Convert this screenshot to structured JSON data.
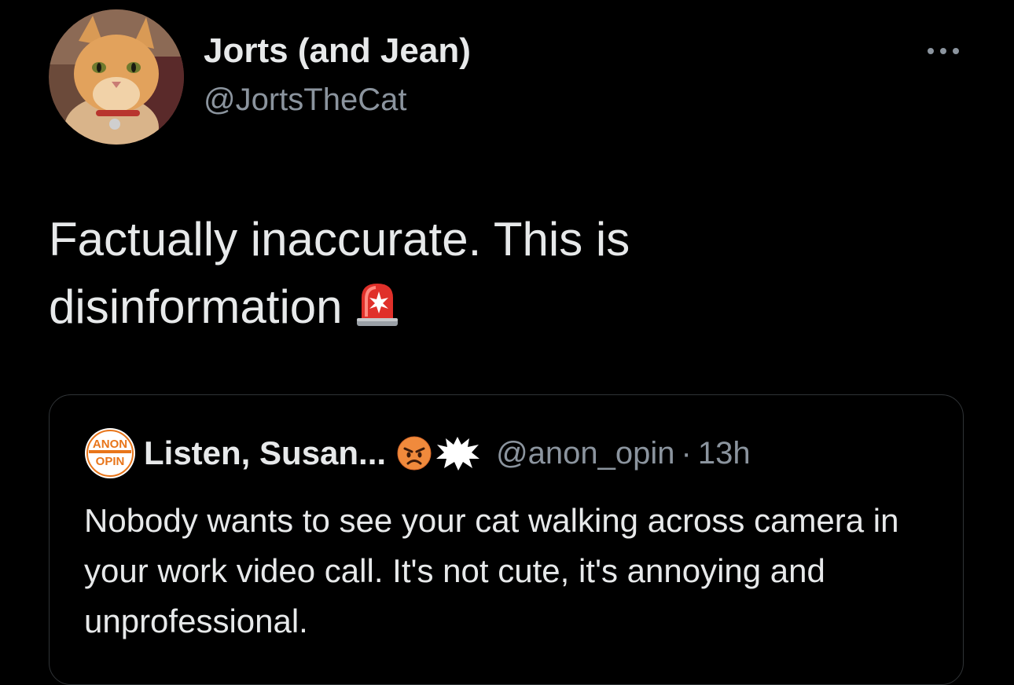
{
  "tweet": {
    "author": {
      "display_name": "Jorts (and Jean)",
      "handle": "@JortsTheCat",
      "avatar_icon": "orange-cat-avatar"
    },
    "more_icon": "more-options-icon",
    "text": "Factually inaccurate. This is disinformation",
    "emoji": "police-siren-icon"
  },
  "quoted_tweet": {
    "avatar_icon": "anon-opin-logo",
    "avatar_text_top": "ANON",
    "avatar_text_bottom": "OPIN",
    "display_name": "Listen, Susan...",
    "name_emojis": [
      "angry-face-icon",
      "anger-bubble-icon"
    ],
    "handle": "@anon_opin",
    "separator": "·",
    "timestamp": "13h",
    "text": "Nobody wants to see your cat walking across camera in your work video call. It's not cute, it's annoying and unprofessional."
  },
  "colors": {
    "background": "#000000",
    "primary_text": "#e7e9ea",
    "secondary_text": "#8b949e",
    "border": "#2f3336",
    "logo_orange": "#e8751a"
  }
}
